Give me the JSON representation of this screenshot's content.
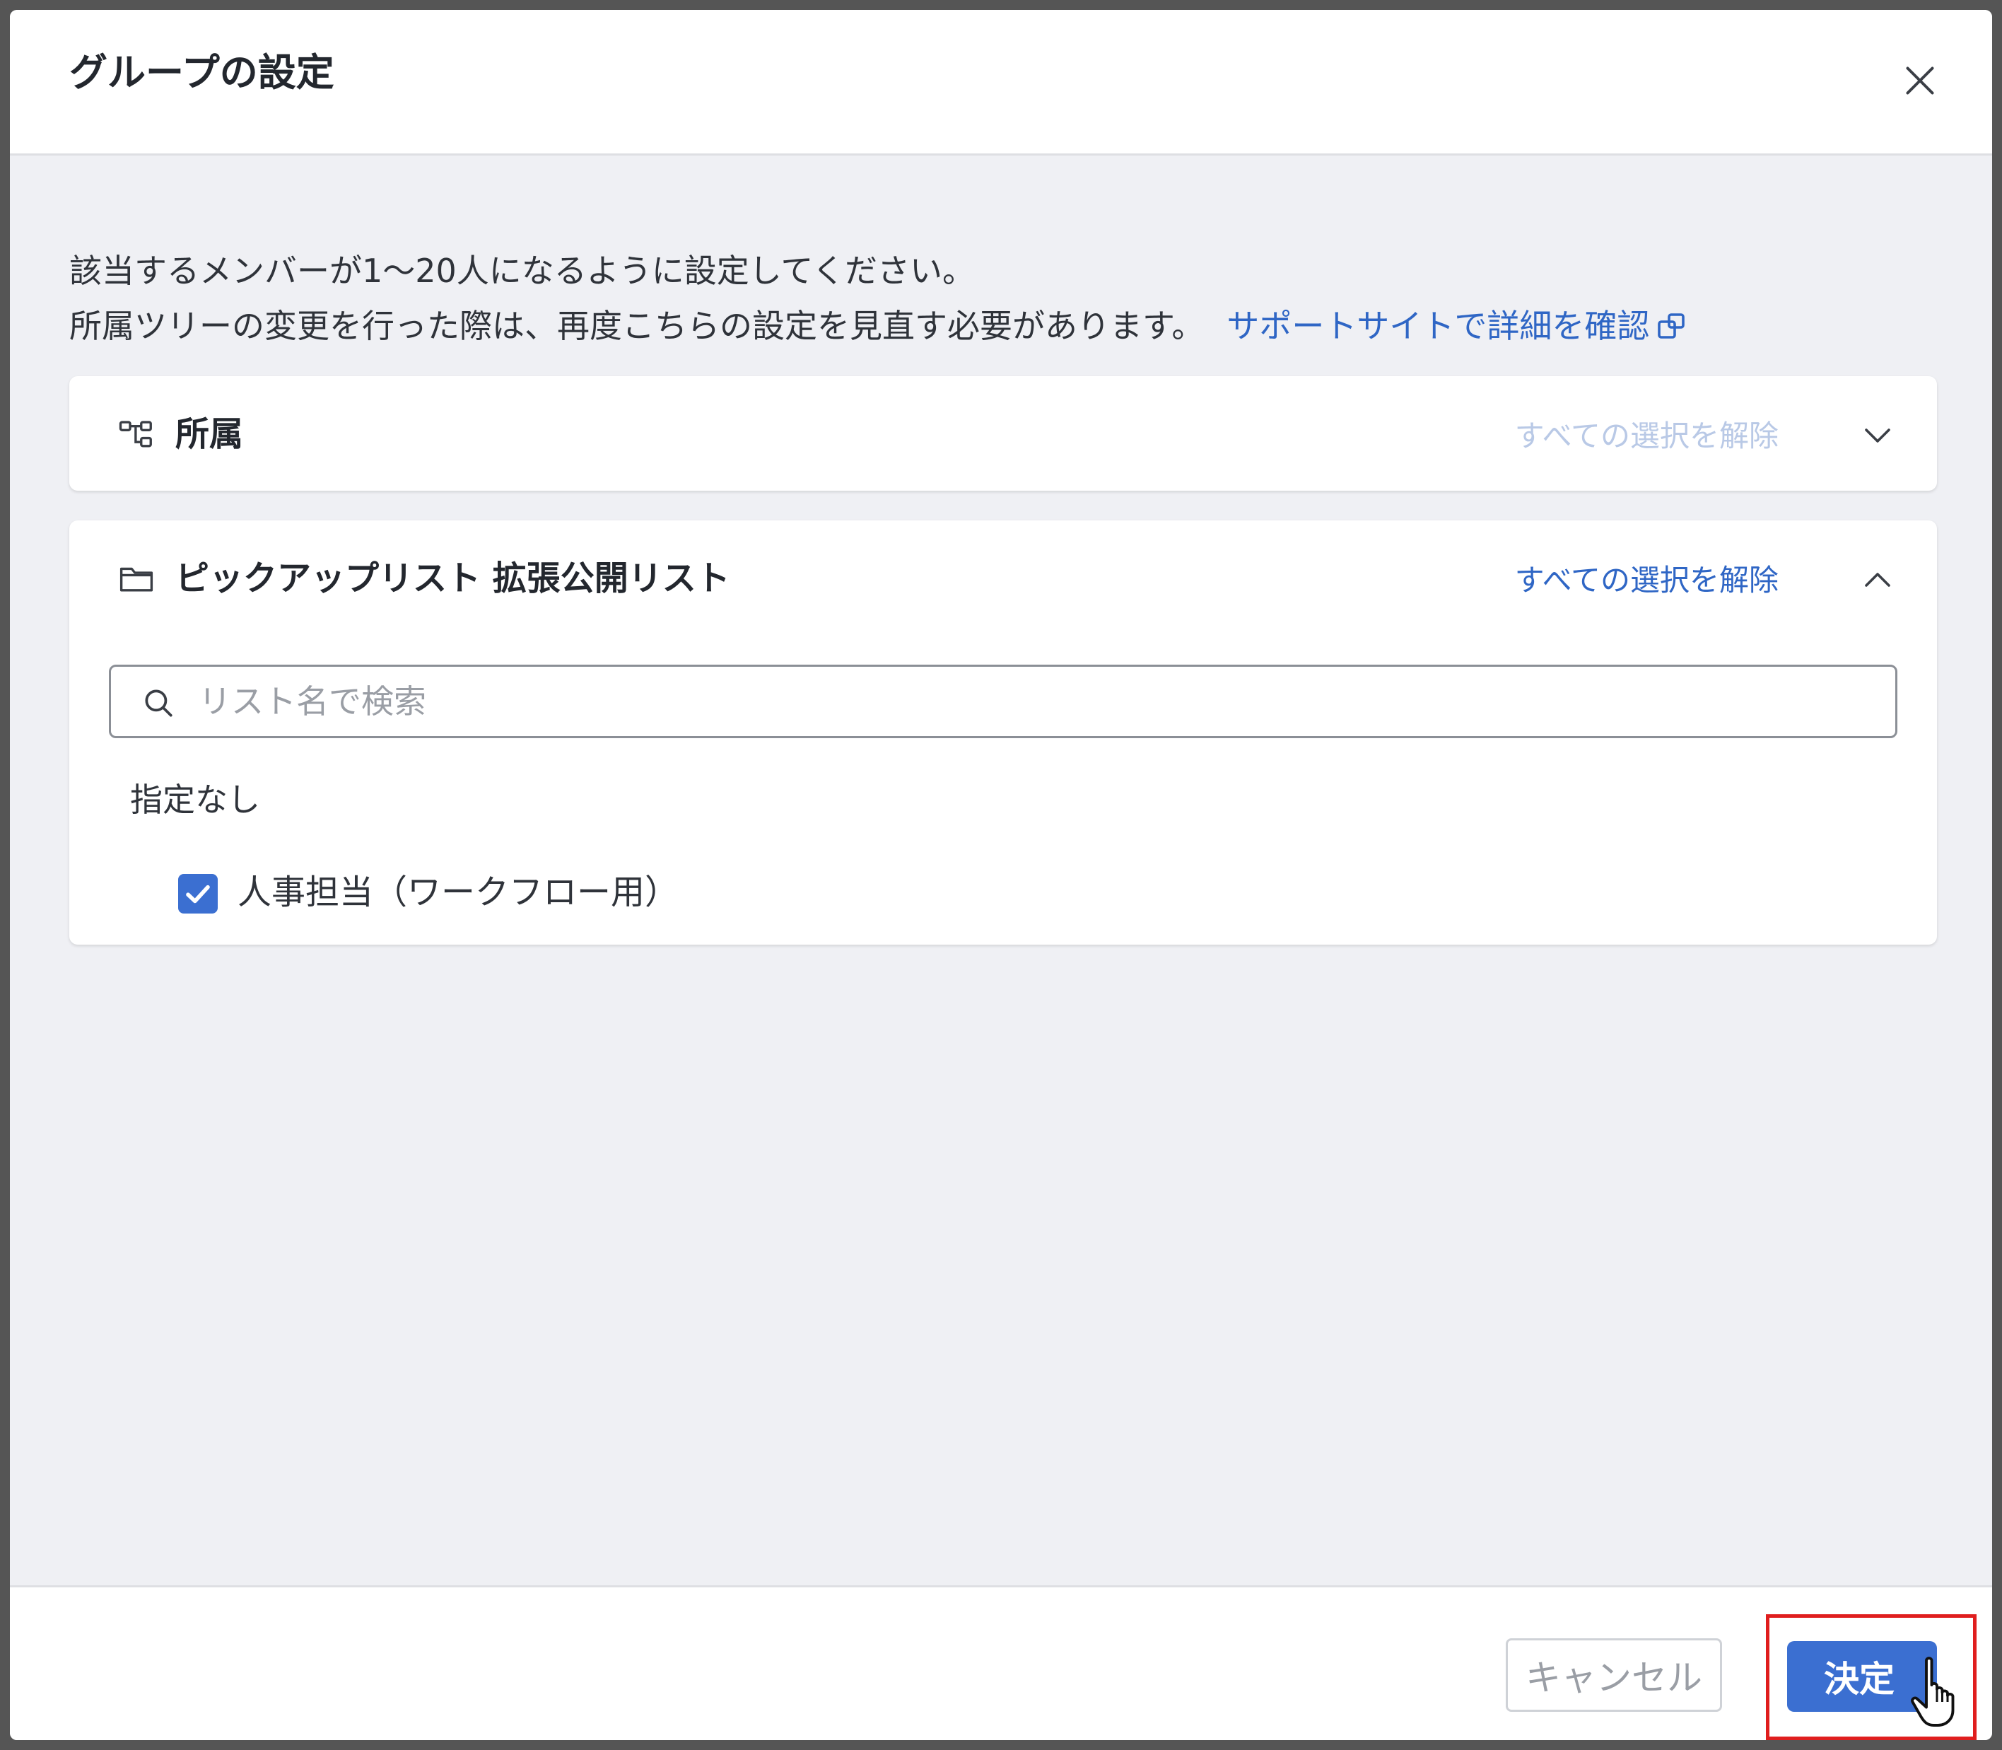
{
  "modal": {
    "title": "グループの設定",
    "close_label": "close"
  },
  "description": {
    "line1": "該当するメンバーが1〜20人になるように設定してください。",
    "line2": "所属ツリーの変更を行った際は、再度こちらの設定を見直す必要があります。",
    "support_link": "サポートサイトで詳細を確認"
  },
  "affiliation_panel": {
    "title": "所属",
    "clear_all": "すべての選択を解除",
    "clear_all_enabled": false,
    "expanded": false,
    "icon": "org-tree-icon"
  },
  "picklist_panel": {
    "title": "ピックアップリスト 拡張公開リスト",
    "clear_all": "すべての選択を解除",
    "clear_all_enabled": true,
    "expanded": true,
    "icon": "folder-icon",
    "search": {
      "placeholder": "リスト名で検索",
      "value": ""
    },
    "group_label": "指定なし",
    "options": [
      {
        "label": "人事担当（ワークフロー用）",
        "checked": true
      }
    ]
  },
  "footer": {
    "cancel_label": "キャンセル",
    "confirm_label": "決定"
  },
  "colors": {
    "accent": "#3b6fd1",
    "link": "#2f66c5",
    "highlight": "#e01e1e",
    "body_bg": "#eff0f4"
  }
}
